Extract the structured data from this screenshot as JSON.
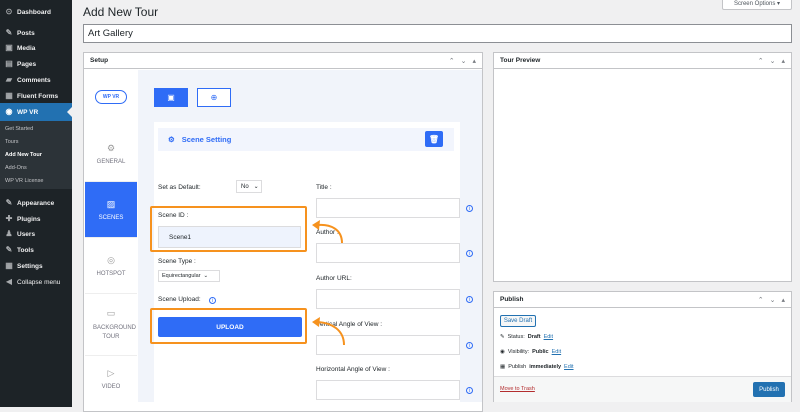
{
  "sidebar": {
    "items": [
      {
        "label": "Dashboard",
        "icon": "dashboard-icon",
        "glyph": "⊙"
      },
      {
        "label": "Posts",
        "icon": "pin-icon",
        "glyph": "✎"
      },
      {
        "label": "Media",
        "icon": "media-icon",
        "glyph": "▣"
      },
      {
        "label": "Pages",
        "icon": "pages-icon",
        "glyph": "▤"
      },
      {
        "label": "Comments",
        "icon": "comments-icon",
        "glyph": "▰"
      },
      {
        "label": "Fluent Forms",
        "icon": "forms-icon",
        "glyph": "▦"
      },
      {
        "label": "WP VR",
        "icon": "wpvr-icon",
        "glyph": "◉"
      }
    ],
    "submenu": [
      "Get Started",
      "Tours",
      "Add New Tour",
      "Add-Ons",
      "WP VR License"
    ],
    "items2": [
      {
        "label": "Appearance",
        "icon": "appearance-icon",
        "glyph": "✎"
      },
      {
        "label": "Plugins",
        "icon": "plugins-icon",
        "glyph": "✚"
      },
      {
        "label": "Users",
        "icon": "users-icon",
        "glyph": "♟"
      },
      {
        "label": "Tools",
        "icon": "tools-icon",
        "glyph": "✎"
      },
      {
        "label": "Settings",
        "icon": "settings-icon",
        "glyph": "▦"
      },
      {
        "label": "Collapse menu",
        "icon": "collapse-icon",
        "glyph": "◀"
      }
    ]
  },
  "page": {
    "title": "Add New Tour",
    "screen_options": "Screen Options ▾",
    "tour_title": "Art Gallery"
  },
  "setup": {
    "header": "Setup",
    "logo": "WP VR",
    "tabs": [
      "GENERAL",
      "SCENES",
      "HOTSPOT",
      "BACKGROUND TOUR",
      "VIDEO"
    ],
    "scene_setting": "Scene Setting",
    "set_default_label": "Set as Default:",
    "set_default_value": "No",
    "scene_id_label": "Scene ID :",
    "scene_id_value": "Scene1",
    "scene_type_label": "Scene Type :",
    "scene_type_value": "Equirectangular",
    "scene_upload_label": "Scene Upload:",
    "upload_button": "UPLOAD",
    "title_label": "Title :",
    "author_label": "Author :",
    "author_url_label": "Author URL:",
    "vertical_label": "Vertical Angle of View :",
    "horizontal_label": "Horizontal Angle of View :"
  },
  "preview": {
    "header": "Tour Preview"
  },
  "publish": {
    "header": "Publish",
    "save_draft": "Save Draft",
    "status_label": "Status:",
    "status_value": "Draft",
    "visibility_label": "Visibility:",
    "visibility_value": "Public",
    "publish_label": "Publish",
    "publish_value": "immediately",
    "edit": "Edit",
    "trash": "Move to Trash",
    "publish_button": "Publish"
  },
  "colors": {
    "accent": "#2f6cf6",
    "wp_blue": "#2271b1",
    "highlight": "#f6921e"
  }
}
